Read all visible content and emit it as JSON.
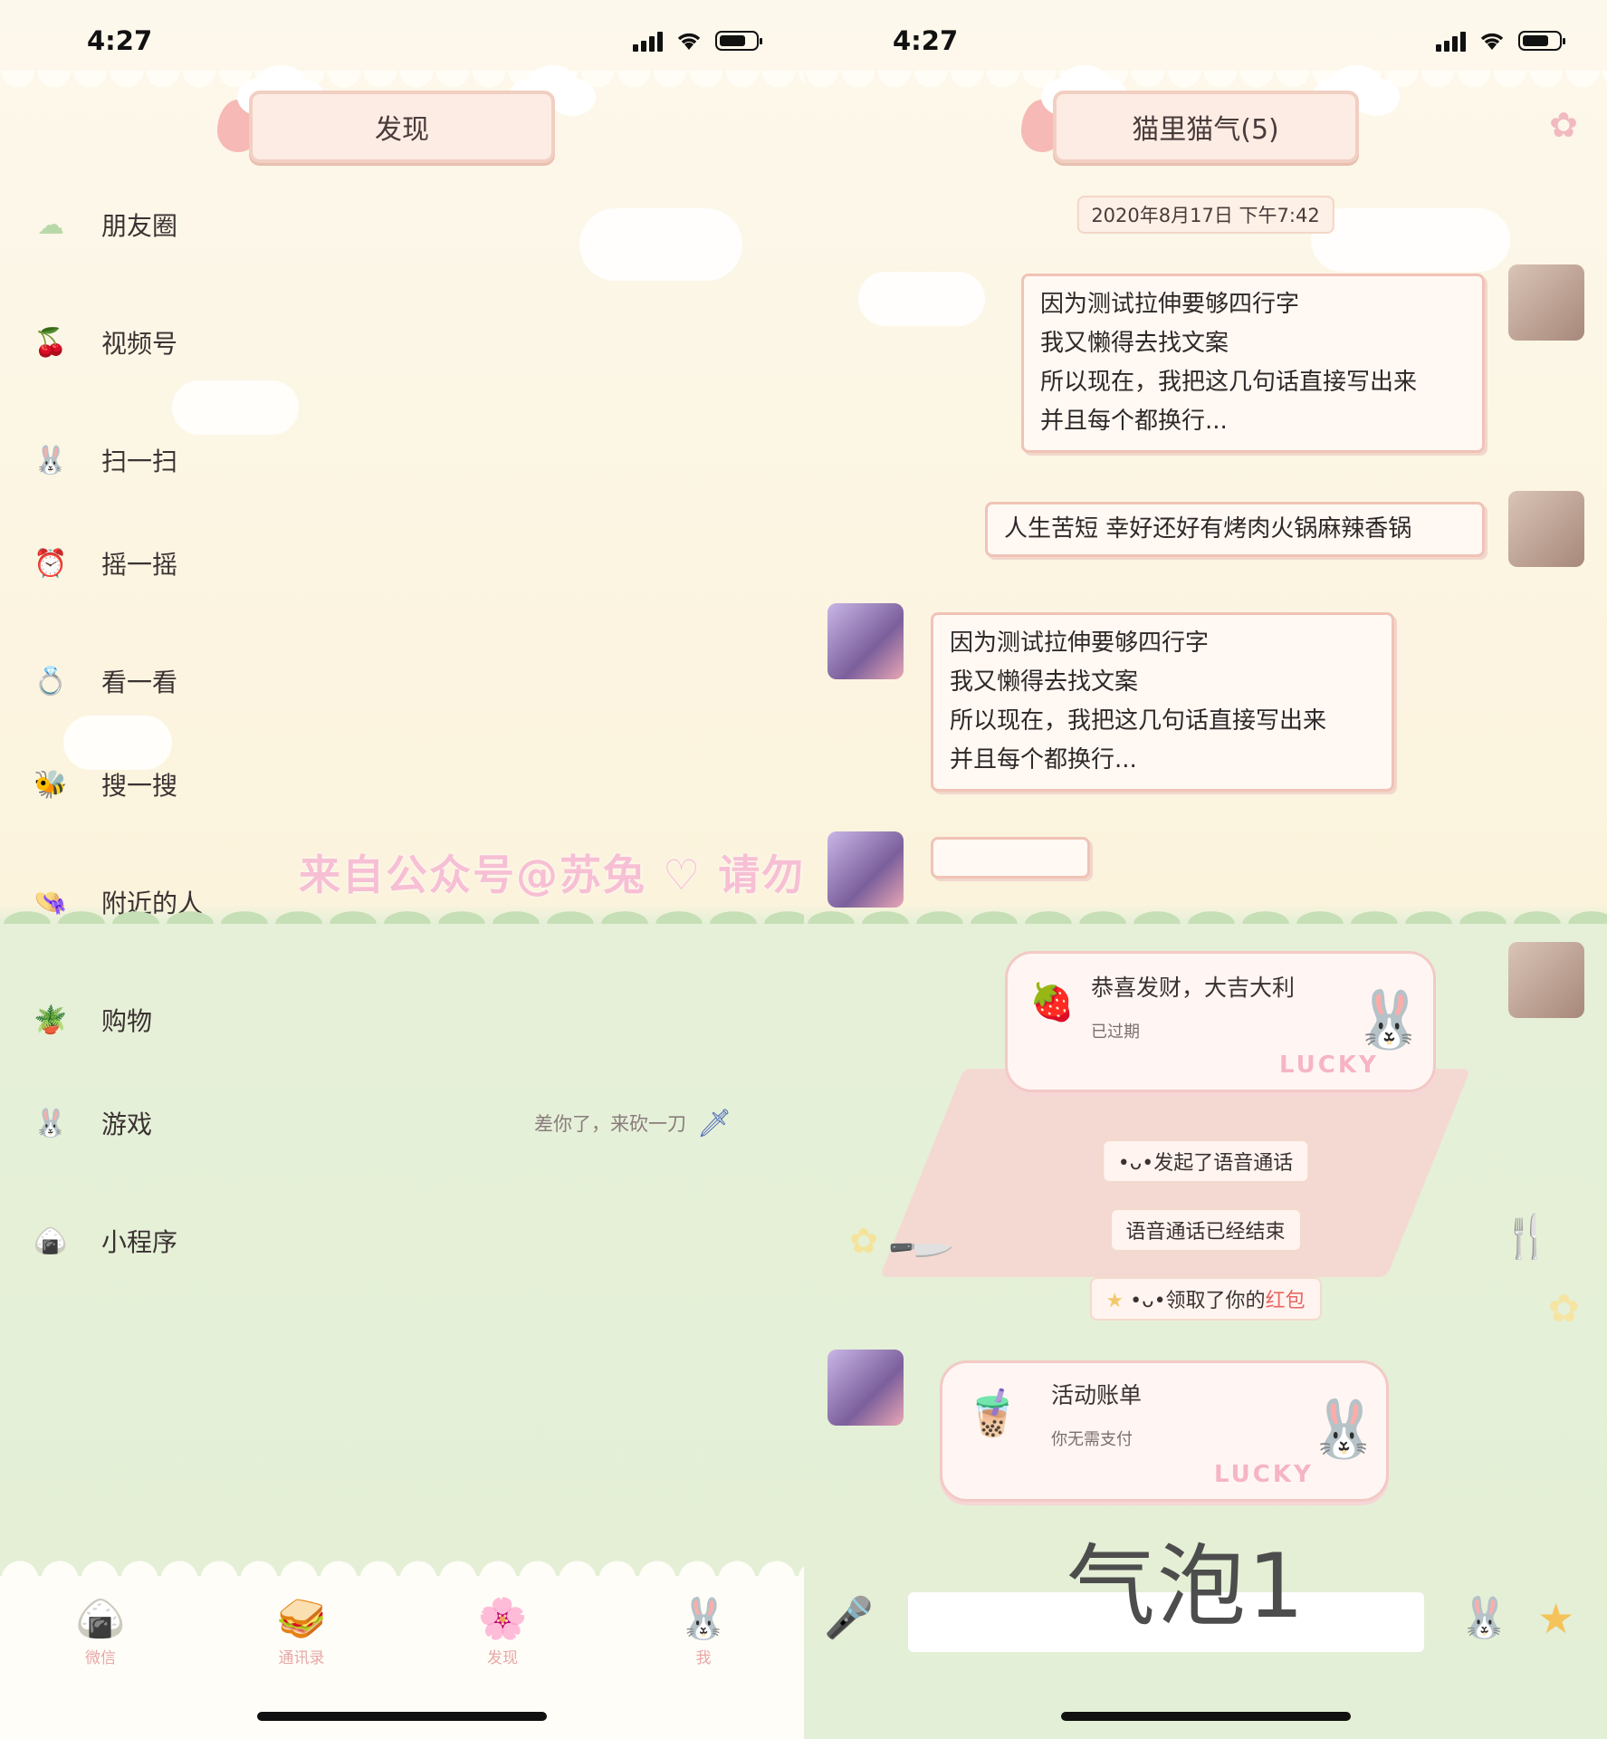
{
  "left": {
    "status": {
      "time": "4:27"
    },
    "title": "发现",
    "menu": [
      {
        "label": "朋友圈",
        "icon": "cloud-icon"
      },
      {
        "label": "视频号",
        "icon": "cherry-icon"
      },
      {
        "label": "扫一扫",
        "icon": "bunny-icon"
      },
      {
        "label": "摇一摇",
        "icon": "alarm-icon"
      },
      {
        "label": "看一看",
        "icon": "ring-icon"
      },
      {
        "label": "搜一搜",
        "icon": "bee-icon"
      },
      {
        "label": "附近的人",
        "icon": "hat-icon"
      },
      {
        "label": "购物",
        "icon": "pot-icon"
      },
      {
        "label": "游戏",
        "icon": "bunny-icon",
        "sub": "差你了，来砍一刀"
      },
      {
        "label": "小程序",
        "icon": "rice-ball-icon"
      }
    ],
    "watermark": "来自公众号@苏兔  ♡  请勿抠图/盗装/未标注转制",
    "tabs": [
      {
        "label": "微信",
        "icon": "rice-ball-icon"
      },
      {
        "label": "通讯录",
        "icon": "sandwich-icon"
      },
      {
        "label": "发现",
        "icon": "flower-icon"
      },
      {
        "label": "我",
        "icon": "bunny-icon"
      }
    ]
  },
  "right": {
    "status": {
      "time": "4:27"
    },
    "title": "猫里猫气(5)",
    "timestamp": "2020年8月17日 下午7:42",
    "messages": {
      "m1": [
        "因为测试拉伸要够四行字",
        "我又懒得去找文案",
        "所以现在，我把这几句话直接写出来",
        "并且每个都换行..."
      ],
      "m2": "人生苦短 幸好还好有烤肉火锅麻辣香锅",
      "m3": [
        "因为测试拉伸要够四行字",
        "我又懒得去找文案",
        "所以现在，我把这几句话直接写出来",
        "并且每个都换行..."
      ]
    },
    "red_packet": {
      "title": "恭喜发财，大吉大利",
      "status": "已过期",
      "badge": "LUCKY"
    },
    "system": {
      "call_start": "•ᴗ•发起了语音通话",
      "call_end": "语音通话已经结束",
      "received_prefix": "•ᴗ•领取了你的",
      "received_highlight": "红包"
    },
    "bill": {
      "title": "活动账单",
      "sub": "你无需支付",
      "badge": "LUCKY"
    },
    "caption": "气泡1"
  },
  "colors": {
    "accent": "#f0c3b6",
    "grass": "#e3efd6",
    "cream": "#fbf3dc",
    "highlight": "#e96565"
  }
}
